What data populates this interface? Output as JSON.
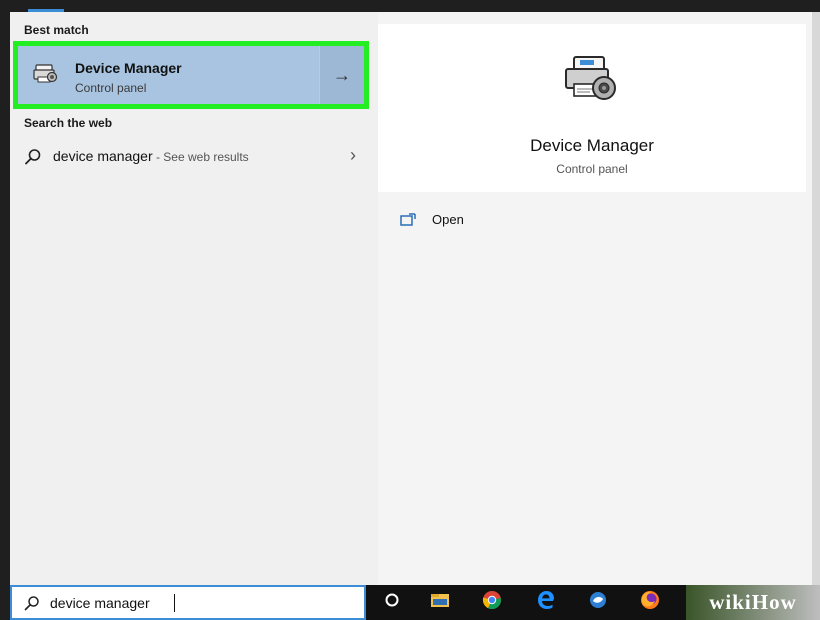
{
  "left_pane": {
    "best_match_header": "Best match",
    "best_match": {
      "title": "Device Manager",
      "subtitle": "Control panel",
      "icon": "device-manager-icon",
      "arrow": "→",
      "highlight_color": "#22ee22",
      "selected_color": "#a8c4e0"
    },
    "search_web_header": "Search the web",
    "web_result": {
      "query": "device manager",
      "suffix": " - See web results",
      "chevron": "›"
    }
  },
  "right_pane": {
    "title": "Device Manager",
    "subtitle": "Control panel",
    "icon": "device-manager-icon",
    "actions": [
      {
        "label": "Open",
        "icon": "open-window-icon"
      }
    ]
  },
  "search_box": {
    "value": "device manager",
    "icon": "search-icon"
  },
  "taskbar": {
    "icons": [
      "cortana-circle-icon",
      "file-explorer-icon",
      "chrome-icon",
      "edge-icon",
      "app-icon",
      "firefox-icon"
    ],
    "watermark": "wikiHow"
  },
  "colors": {
    "accent": "#3b8ed6",
    "panel_bg": "#f0f0f0",
    "taskbar_bg": "#111111"
  }
}
